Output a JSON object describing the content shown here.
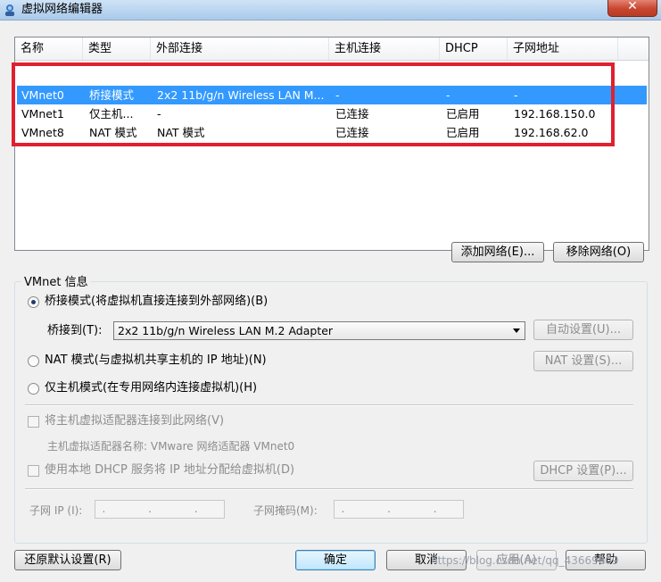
{
  "window": {
    "title": "虚拟网络编辑器",
    "close": "✕"
  },
  "table": {
    "columns": [
      "名称",
      "类型",
      "外部连接",
      "主机连接",
      "DHCP",
      "子网地址"
    ],
    "rows": [
      {
        "name": "VMnet0",
        "type": "桥接模式",
        "external": "2x2 11b/g/n Wireless LAN M...",
        "host": "-",
        "dhcp": "-",
        "subnet": "-",
        "selected": true
      },
      {
        "name": "VMnet1",
        "type": "仅主机...",
        "external": "-",
        "host": "已连接",
        "dhcp": "已启用",
        "subnet": "192.168.150.0",
        "selected": false
      },
      {
        "name": "VMnet8",
        "type": "NAT 模式",
        "external": "NAT 模式",
        "host": "已连接",
        "dhcp": "已启用",
        "subnet": "192.168.62.0",
        "selected": false
      }
    ]
  },
  "buttons": {
    "add_network": "添加网络(E)...",
    "remove_network": "移除网络(O)",
    "auto_settings": "自动设置(U)...",
    "nat_settings": "NAT 设置(S)...",
    "dhcp_settings": "DHCP 设置(P)...",
    "restore_defaults": "还原默认设置(R)",
    "ok": "确定",
    "cancel": "取消",
    "apply": "应用(A)",
    "help": "帮助"
  },
  "vmnet_info": {
    "title": "VMnet 信息",
    "bridged_label": "桥接模式(将虚拟机直接连接到外部网络)(B)",
    "bridged_to_label": "桥接到(T):",
    "bridged_to_value": "2x2 11b/g/n Wireless LAN M.2 Adapter",
    "nat_label": "NAT 模式(与虚拟机共享主机的 IP 地址)(N)",
    "hostonly_label": "仅主机模式(在专用网络内连接虚拟机)(H)",
    "connect_adapter_label": "将主机虚拟适配器连接到此网络(V)",
    "adapter_name_label": "主机虚拟适配器名称: VMware 网络适配器 VMnet0",
    "dhcp_label": "使用本地 DHCP 服务将 IP 地址分配给虚拟机(D)",
    "subnet_ip_label": "子网 IP (I):",
    "subnet_mask_label": "子网掩码(M):",
    "ip_placeholder": ". . ."
  },
  "watermark": "https://blog.csdn.net/qq_43669009"
}
